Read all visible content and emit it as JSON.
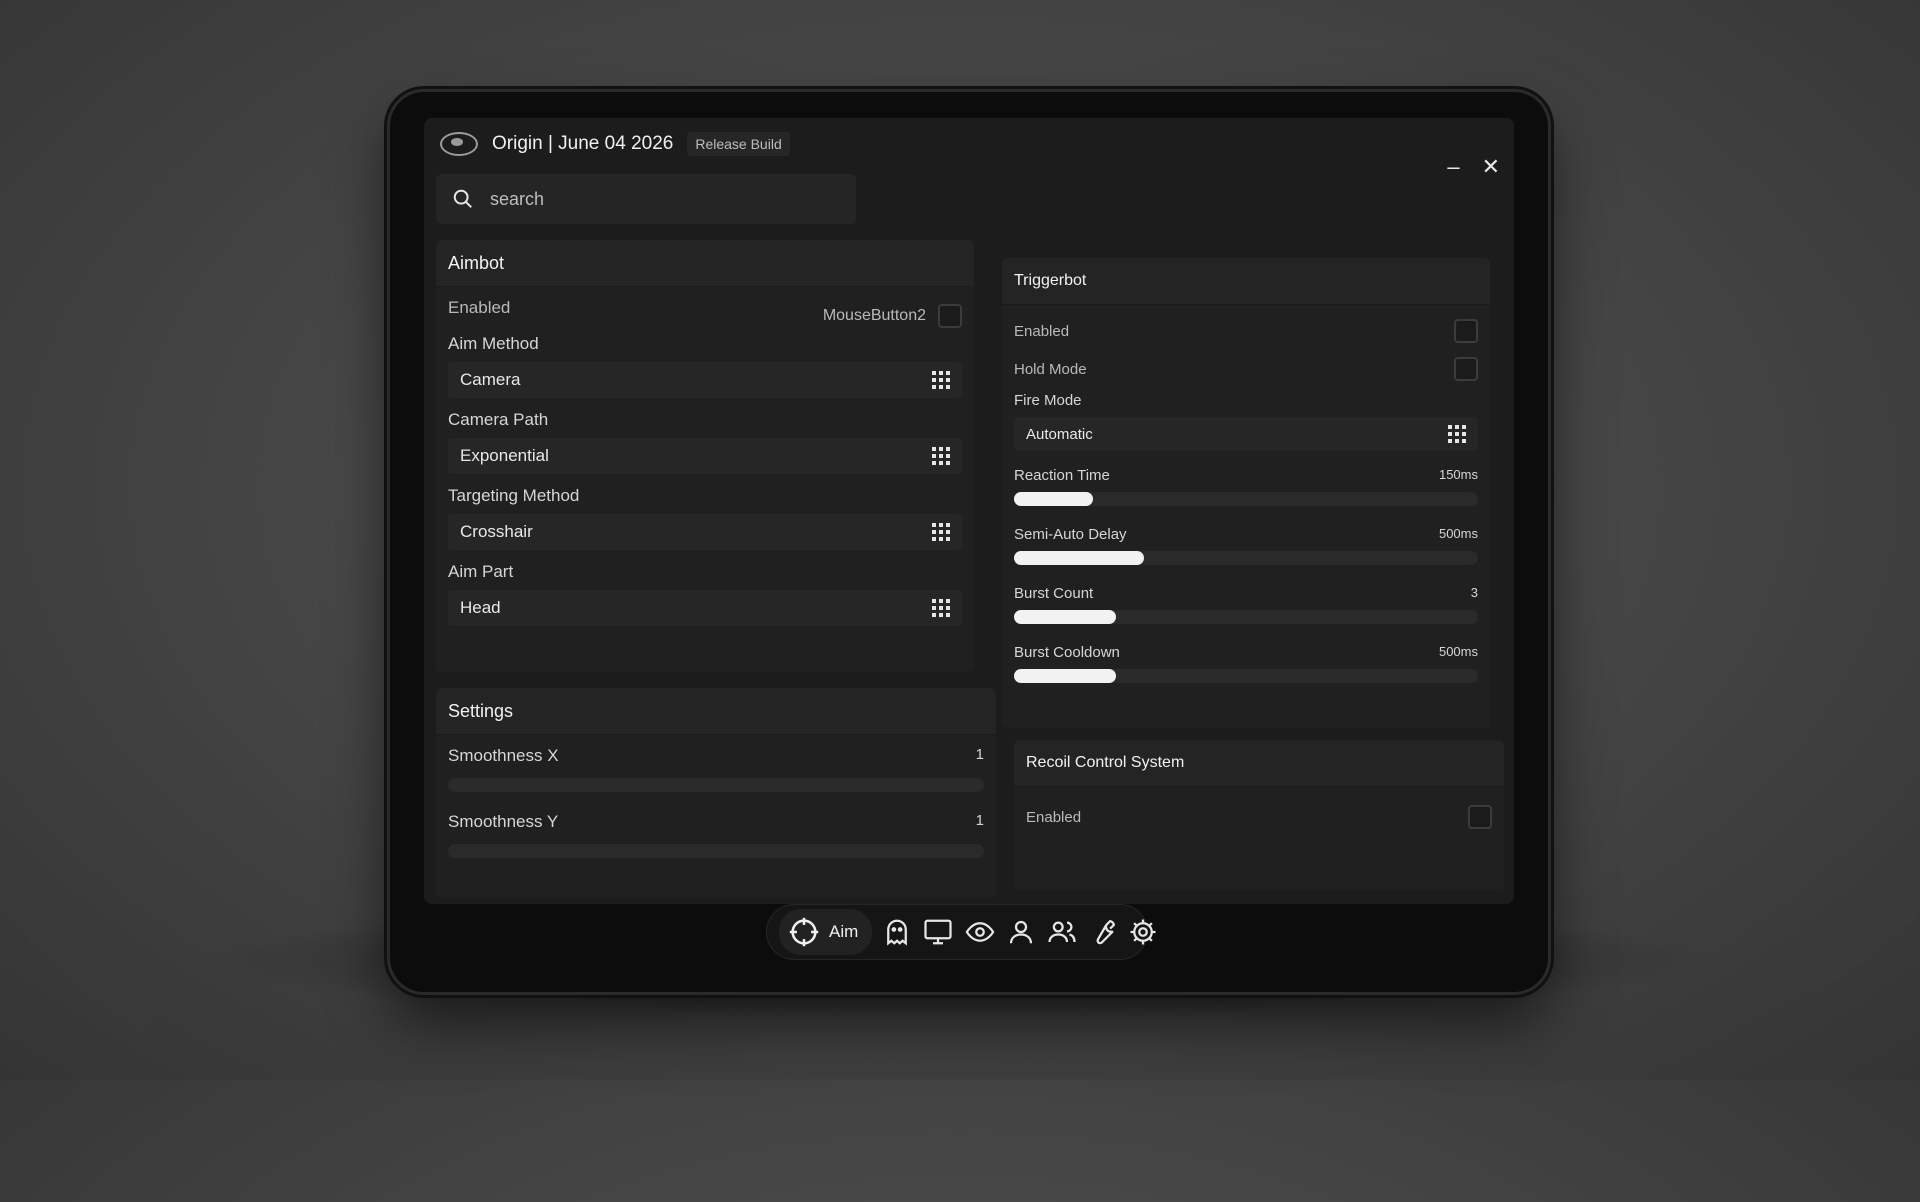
{
  "window": {
    "title": "Origin | June 04 2026",
    "badge": "Release Build",
    "minimize": "–",
    "close": "✕"
  },
  "search": {
    "placeholder": "search"
  },
  "aimbot": {
    "title": "Aimbot",
    "enabled_label": "Enabled",
    "keybind": "MouseButton2",
    "aim_method_label": "Aim Method",
    "aim_method_value": "Camera",
    "camera_path_label": "Camera Path",
    "camera_path_value": "Exponential",
    "targeting_label": "Targeting Method",
    "targeting_value": "Crosshair",
    "aim_part_label": "Aim Part",
    "aim_part_value": "Head"
  },
  "settings": {
    "title": "Settings",
    "smooth_x_label": "Smoothness X",
    "smooth_x_value": "1",
    "smooth_y_label": "Smoothness Y",
    "smooth_y_value": "1"
  },
  "triggerbot": {
    "title": "Triggerbot",
    "enabled_label": "Enabled",
    "hold_label": "Hold Mode",
    "fire_mode_label": "Fire Mode",
    "fire_mode_value": "Automatic",
    "reaction_label": "Reaction Time",
    "reaction_value": "150ms",
    "reaction_fill": 0.17,
    "semi_label": "Semi-Auto Delay",
    "semi_value": "500ms",
    "semi_fill": 0.28,
    "burst_label": "Burst Count",
    "burst_value": "3",
    "burst_fill": 0.22,
    "cooldown_label": "Burst Cooldown",
    "cooldown_value": "500ms",
    "cooldown_fill": 0.22
  },
  "rcs": {
    "title": "Recoil Control System",
    "enabled_label": "Enabled"
  },
  "dock": {
    "active_label": "Aim",
    "icons": [
      "crosshair-icon",
      "ghost-icon",
      "monitor-icon",
      "eye-icon",
      "user-icon",
      "users-icon",
      "wrench-icon",
      "gear-icon"
    ]
  }
}
